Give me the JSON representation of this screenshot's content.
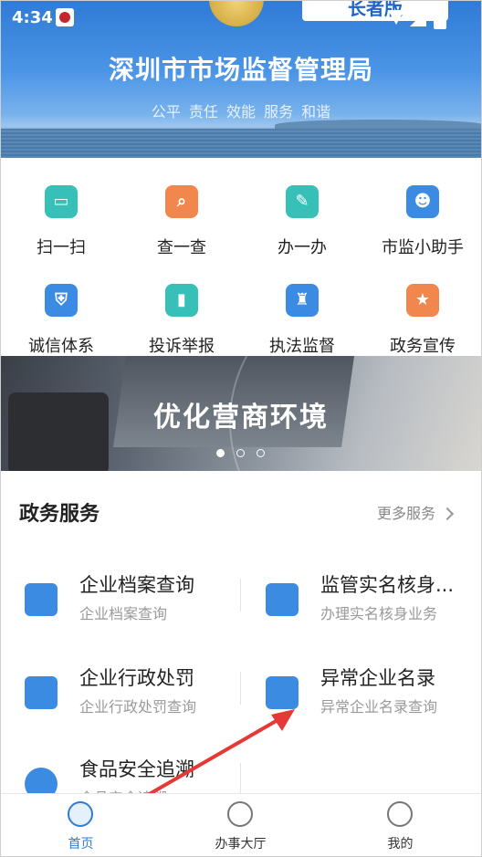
{
  "status_bar": {
    "time": "4:34"
  },
  "header": {
    "title": "深圳市市场监督管理局",
    "subtitle": "公平 责任 效能 服务 和谐",
    "elder_mode_label": "长者版"
  },
  "shortcuts": [
    {
      "label": "扫一扫",
      "icon": "scan-icon",
      "color": "#36c0b8"
    },
    {
      "label": "查一查",
      "icon": "search-doc-icon",
      "color": "#f1874c"
    },
    {
      "label": "办一办",
      "icon": "pencil-icon",
      "color": "#36c0b8"
    },
    {
      "label": "市监小助手",
      "icon": "robot-icon",
      "color": "#3c8be3"
    },
    {
      "label": "诚信体系",
      "icon": "shield-doc-icon",
      "color": "#3c8be3"
    },
    {
      "label": "投诉举报",
      "icon": "bookmark-icon",
      "color": "#36c0b8"
    },
    {
      "label": "执法监督",
      "icon": "officer-icon",
      "color": "#3c8be3"
    },
    {
      "label": "政务宣传",
      "icon": "star-doc-icon",
      "color": "#f1874c"
    }
  ],
  "banner": {
    "title": "优化营商环境",
    "active_dot": 1,
    "dot_count": 3
  },
  "services_section": {
    "title": "政务服务",
    "more_label": "更多服务",
    "items": [
      {
        "name": "企业档案查询",
        "desc": "企业档案查询",
        "icon": "archive-search-icon"
      },
      {
        "name": "监管实名核身...",
        "desc": "办理实名核身业务",
        "icon": "id-card-icon"
      },
      {
        "name": "企业行政处罚",
        "desc": "企业行政处罚查询",
        "icon": "penalty-icon"
      },
      {
        "name": "异常企业名录",
        "desc": "异常企业名录查询",
        "icon": "warning-building-icon"
      },
      {
        "name": "食品安全追溯",
        "desc": "食品安全追溯",
        "icon": "wheat-icon"
      }
    ]
  },
  "tabbar": [
    {
      "label": "首页",
      "icon": "home-icon",
      "active": true
    },
    {
      "label": "办事大厅",
      "icon": "handshake-icon",
      "active": false
    },
    {
      "label": "我的",
      "icon": "user-icon",
      "active": false
    }
  ],
  "colors": {
    "primary": "#2f7bd6",
    "teal": "#36c0b8",
    "orange": "#f1874c",
    "blue": "#3c8be3",
    "arrow": "#e53935"
  }
}
